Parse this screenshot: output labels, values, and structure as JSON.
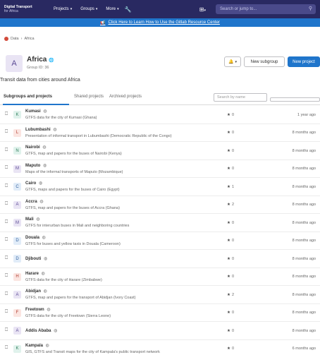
{
  "topbar": {
    "brand_line1": "Digital Transport",
    "brand_line2": "for Africa",
    "projects_label": "Projects",
    "groups_label": "Groups",
    "more_label": "More",
    "search_placeholder": "Search or jump to...",
    "bg_color": "#292961"
  },
  "banner": {
    "text": "Click Here to Learn How to Use the Gitlab Resource Center",
    "bg_color": "#1f75cb"
  },
  "breadcrumb": {
    "root": "Data",
    "current": "Africa"
  },
  "group": {
    "initial": "A",
    "name": "Africa",
    "id_text": "Group ID: 36",
    "description": "Transit data from cities around Africa",
    "notification_icon": "bell-icon",
    "new_subgroup_label": "New subgroup",
    "new_project_label": "New project"
  },
  "tabs": {
    "subgroups_and_projects": "Subgroups and projects",
    "shared_projects": "Shared projects",
    "archived_projects": "Archived projects",
    "search_placeholder": "Search by name"
  },
  "projects": [
    {
      "initial": "K",
      "avatar_bg": "#e0f2ec",
      "avatar_fg": "#2e7d5b",
      "name": "Kumasi",
      "description": "GTFS data for the city of Kumasi (Ghana)",
      "stars": "0",
      "updated": "1 year ago"
    },
    {
      "initial": "L",
      "avatar_bg": "#fbe5e1",
      "avatar_fg": "#b03a2e",
      "name": "Lubumbashi",
      "description": "Presentation of informal transport in Lubumbashi (Democratic Republic of the Congo)",
      "stars": "0",
      "updated": "8 months ago"
    },
    {
      "initial": "N",
      "avatar_bg": "#e0f2ec",
      "avatar_fg": "#2e7d5b",
      "name": "Nairobi",
      "description": "GTFS, map and papers for the buses of Nairobi (Kenya)",
      "stars": "0",
      "updated": "8 months ago"
    },
    {
      "initial": "M",
      "avatar_bg": "#e9e4f4",
      "avatar_fg": "#5b4a94",
      "name": "Maputo",
      "description": "Maps of the informal transports of Maputo (Mozambique)",
      "stars": "0",
      "updated": "8 months ago"
    },
    {
      "initial": "C",
      "avatar_bg": "#e1ecf8",
      "avatar_fg": "#2f5f9e",
      "name": "Cairo",
      "description": "GTFS, maps and papers for the buses of Cairo (Egypt)",
      "stars": "1",
      "updated": "8 months ago"
    },
    {
      "initial": "A",
      "avatar_bg": "#e9e4f4",
      "avatar_fg": "#5b4a94",
      "name": "Accra",
      "description": "GTFS, map and papers for the buses of Accra (Ghana)",
      "stars": "2",
      "updated": "8 months ago"
    },
    {
      "initial": "M",
      "avatar_bg": "#e9e4f4",
      "avatar_fg": "#5b4a94",
      "name": "Mali",
      "description": "GTFS for interurban buses in Mali and neighboring countries",
      "stars": "0",
      "updated": "8 months ago"
    },
    {
      "initial": "D",
      "avatar_bg": "#e1ecf8",
      "avatar_fg": "#2f5f9e",
      "name": "Douala",
      "description": "GTFS for buses and yellow taxis in Douala (Cameroon)",
      "stars": "0",
      "updated": "8 months ago"
    },
    {
      "initial": "D",
      "avatar_bg": "#e1ecf8",
      "avatar_fg": "#2f5f9e",
      "name": "Djibouti",
      "description": "",
      "stars": "0",
      "updated": "8 months ago"
    },
    {
      "initial": "H",
      "avatar_bg": "#fbe5e1",
      "avatar_fg": "#b03a2e",
      "name": "Harare",
      "description": "GTFS data for the city of Harare (Zimbabwe)",
      "stars": "0",
      "updated": "8 months ago"
    },
    {
      "initial": "A",
      "avatar_bg": "#e9e4f4",
      "avatar_fg": "#5b4a94",
      "name": "Abidjan",
      "description": "GTFS, map and papers for the transport of Abidjan (Ivory Coast)",
      "stars": "2",
      "updated": "8 months ago"
    },
    {
      "initial": "F",
      "avatar_bg": "#fbe5e1",
      "avatar_fg": "#b03a2e",
      "name": "Freetown",
      "description": "GTFS data for the city of Freetown (Sierra Leone)",
      "stars": "0",
      "updated": "8 months ago"
    },
    {
      "initial": "A",
      "avatar_bg": "#e9e4f4",
      "avatar_fg": "#5b4a94",
      "name": "Addis Ababa",
      "description": "",
      "stars": "0",
      "updated": "8 months ago"
    },
    {
      "initial": "K",
      "avatar_bg": "#e0f2ec",
      "avatar_fg": "#2e7d5b",
      "name": "Kampala",
      "description": "GIS, GTFS and Transit maps for the city of Kampala's public transport network",
      "stars": "0",
      "updated": "6 months ago"
    }
  ]
}
